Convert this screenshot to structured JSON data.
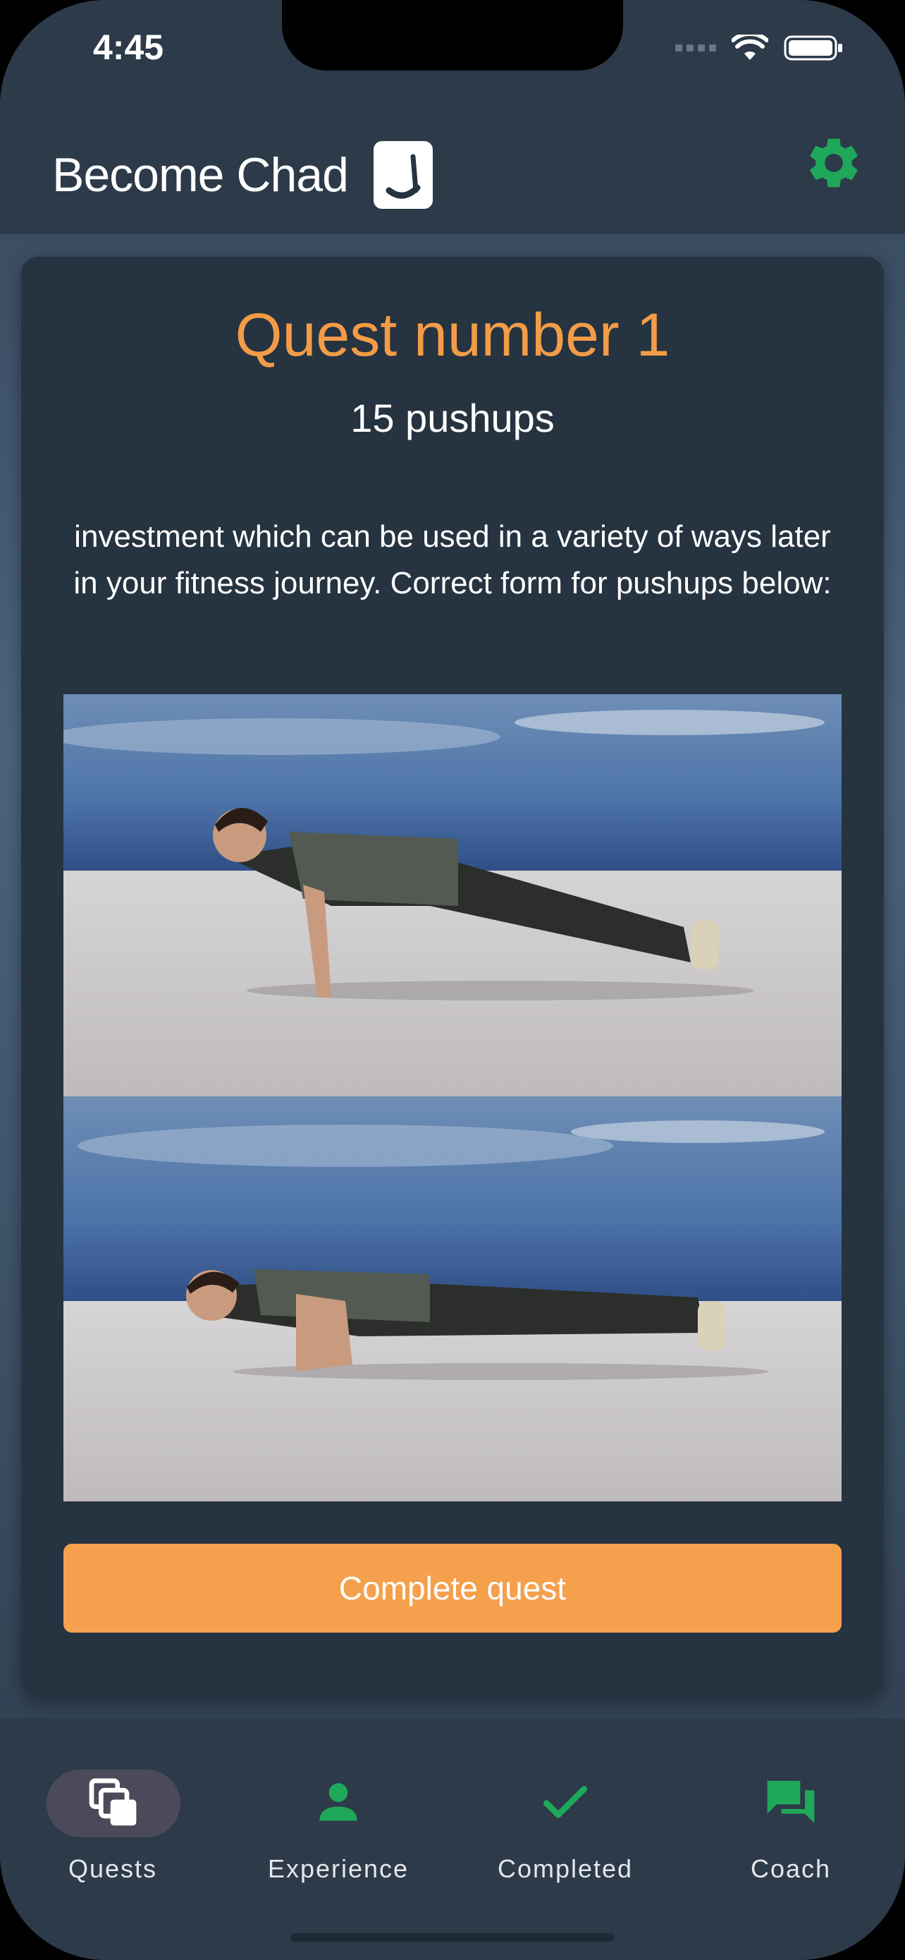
{
  "status": {
    "time": "4:45"
  },
  "header": {
    "brand": "Become Chad"
  },
  "quest": {
    "title": "Quest number 1",
    "subtitle": "15 pushups",
    "description": "investment which can be used in a variety of ways later in your fitness journey. Correct form for pushups below:",
    "cta": "Complete quest"
  },
  "nav": {
    "items": [
      {
        "label": "Quests",
        "icon": "quests-stack-icon",
        "active": true
      },
      {
        "label": "Experience",
        "icon": "person-icon",
        "active": false
      },
      {
        "label": "Completed",
        "icon": "check-icon",
        "active": false
      },
      {
        "label": "Coach",
        "icon": "chat-icon",
        "active": false
      }
    ]
  },
  "colors": {
    "accent": "#f39c47",
    "button": "#f5a04c",
    "nav_icon": "#1fa85a",
    "card": "#263340",
    "appbar": "#2c3a49"
  }
}
